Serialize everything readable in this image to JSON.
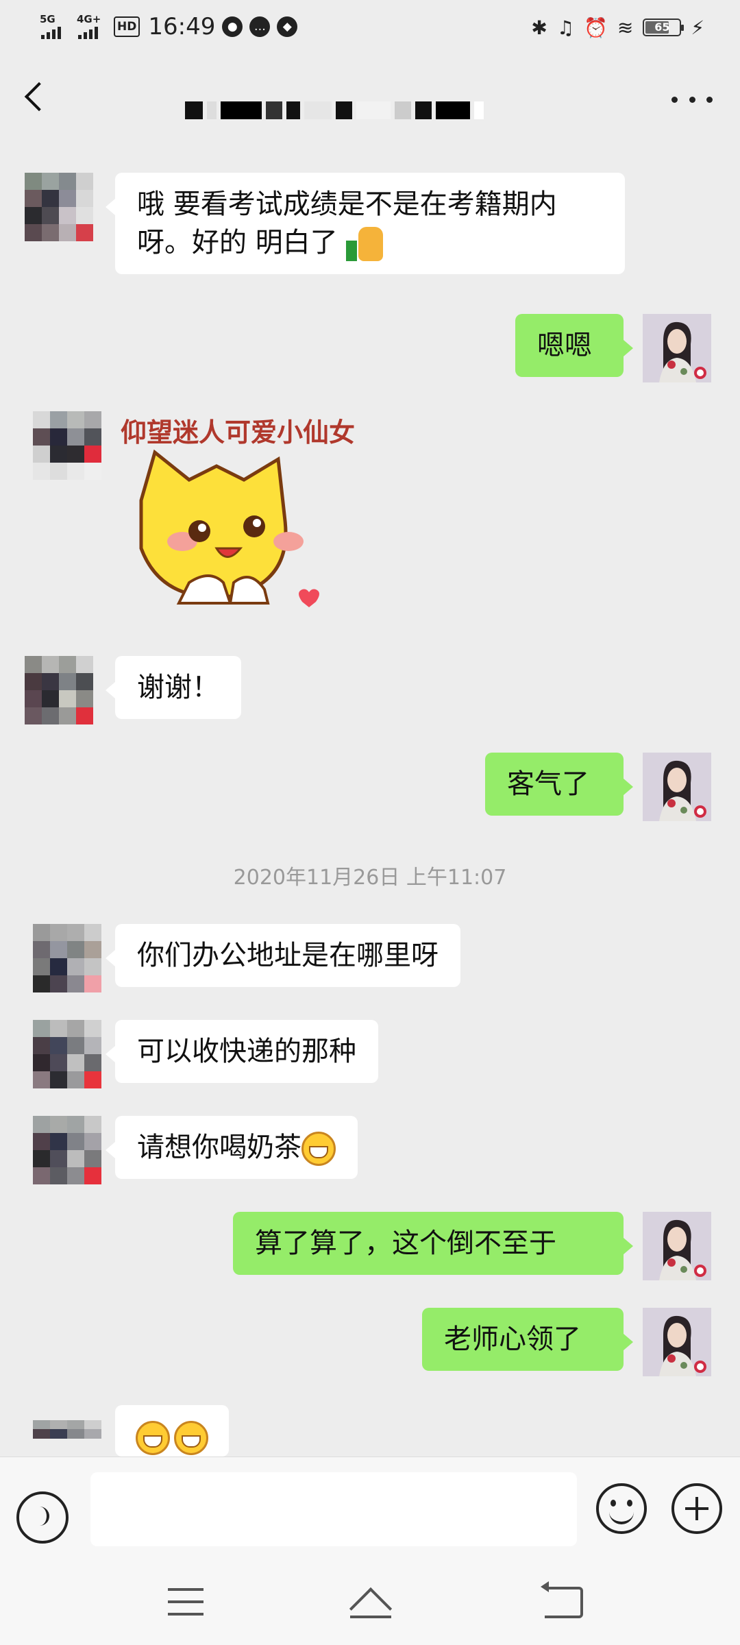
{
  "status_bar": {
    "network_1": "5G",
    "network_2": "4G+",
    "hd_badge": "HD",
    "time": "16:49",
    "battery": "65",
    "battery_level": 0.65,
    "icons": [
      "signal-icon",
      "wechat-icon",
      "message-icon",
      "compass-icon",
      "bluetooth-icon",
      "headphone-icon",
      "alarm-icon",
      "wifi-icon",
      "charging-icon"
    ]
  },
  "header": {
    "title": "",
    "icons": [
      "back-arrow-icon",
      "more-dots-icon"
    ]
  },
  "messages": [
    {
      "side": "in",
      "text": "哦 要看考试成绩是不是在考籍期内呀。好的 明白了",
      "emoji": "thumbs-up-icon"
    },
    {
      "side": "out",
      "text": "嗯嗯"
    },
    {
      "side": "in",
      "sticker_caption": "仰望迷人可爱小仙女",
      "sticker": "cute-yellow-face-sticker"
    },
    {
      "side": "in",
      "text": "谢谢！"
    },
    {
      "side": "out",
      "text": "客气了"
    },
    {
      "side": "in",
      "text": "你们办公地址是在哪里呀"
    },
    {
      "side": "in",
      "text": "可以收快递的那种"
    },
    {
      "side": "in",
      "text": "请想你喝奶茶",
      "emoji": "grin-emoji"
    },
    {
      "side": "out",
      "text": "算了算了，这个倒不至于"
    },
    {
      "side": "out",
      "text": "老师心领了"
    },
    {
      "side": "in",
      "emoji": "laughing-tears-emoji"
    }
  ],
  "timestamp": "2020年11月26日 上午11:07",
  "input_bar": {
    "value": "",
    "icons": [
      "voice-icon",
      "emoji-icon",
      "plus-icon"
    ]
  },
  "nav_bar": {
    "icons": [
      "menu-icon",
      "home-icon",
      "back-icon"
    ]
  },
  "colors": {
    "background": "#ededed",
    "incoming_bubble": "#ffffff",
    "outgoing_bubble": "#95ec69",
    "timestamp_text": "#999999"
  }
}
